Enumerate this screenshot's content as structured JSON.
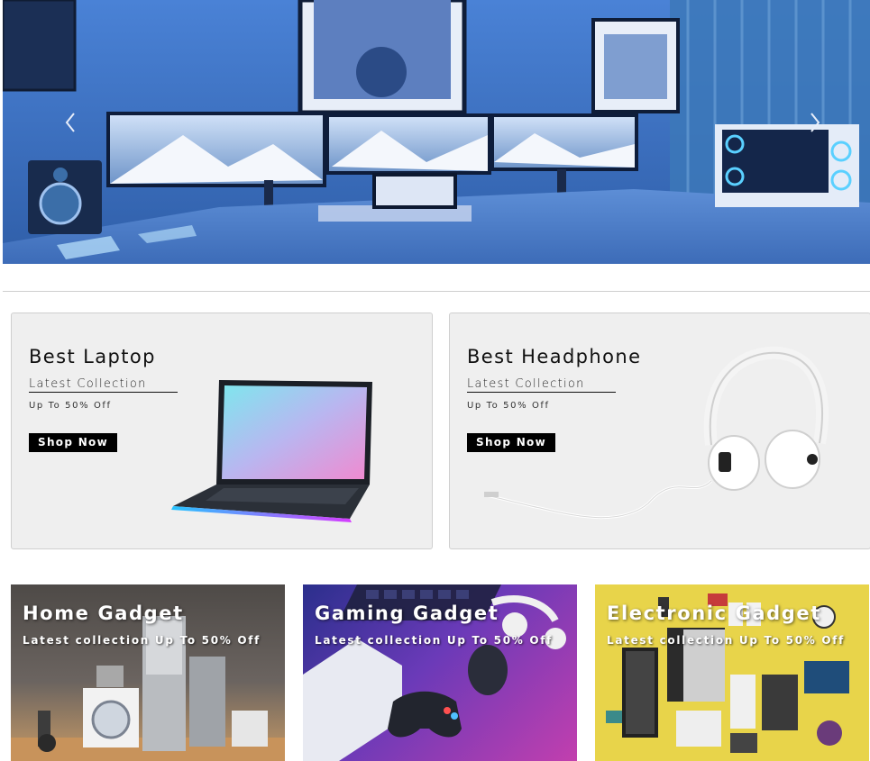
{
  "hero": {
    "image_description_icon": "desk-setup-image",
    "prev_icon": "chevron-left-icon",
    "next_icon": "chevron-right-icon"
  },
  "promos": [
    {
      "title": "Best Laptop",
      "subtitle": "Latest Collection",
      "offer": "Up To 50% Off",
      "button": "Shop Now",
      "icon": "laptop-image"
    },
    {
      "title": "Best Headphone",
      "subtitle": "Latest Collection",
      "offer": "Up To 50% Off",
      "button": "Shop Now",
      "icon": "headphone-image"
    }
  ],
  "categories": [
    {
      "title": "Home Gadget",
      "subtitle": "Latest collection Up To 50% Off",
      "icon": "home-appliances-image"
    },
    {
      "title": "Gaming Gadget",
      "subtitle": "Latest collection Up To 50% Off",
      "icon": "gaming-gear-image"
    },
    {
      "title": "Electronic Gadget",
      "subtitle": "Latest collection Up To 50% Off",
      "icon": "electronics-flatlay-image"
    }
  ],
  "colors": {
    "button_bg": "#000000",
    "card_bg": "#efefef",
    "hero_blue": "#3f74c8"
  }
}
